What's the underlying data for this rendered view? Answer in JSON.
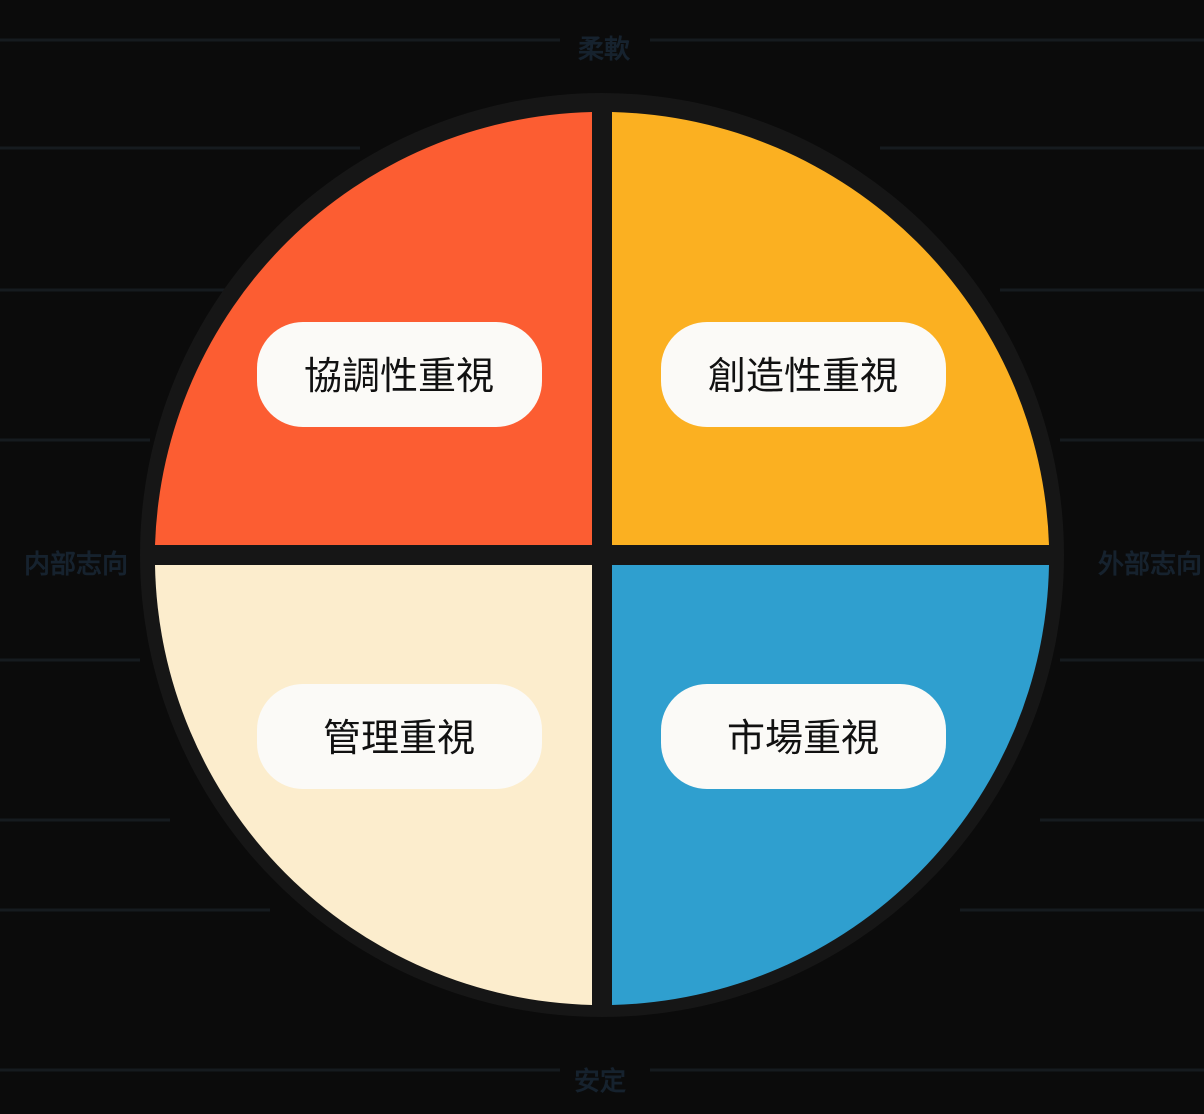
{
  "diagram": {
    "axes": {
      "top": "柔軟",
      "bottom": "安定",
      "left": "内部志向",
      "right": "外部志向"
    },
    "quadrants": [
      {
        "position": "top-left",
        "label": "協調性重視",
        "color": "#fc5d32"
      },
      {
        "position": "top-right",
        "label": "創造性重視",
        "color": "#fbb021"
      },
      {
        "position": "bottom-left",
        "label": "管理重視",
        "color": "#fcedcd"
      },
      {
        "position": "bottom-right",
        "label": "市場重視",
        "color": "#2f9fcf"
      }
    ],
    "colors": {
      "background": "#0b0b0b",
      "outline": "#161616",
      "pill": "#fbfaf7",
      "text": "#111111"
    }
  }
}
